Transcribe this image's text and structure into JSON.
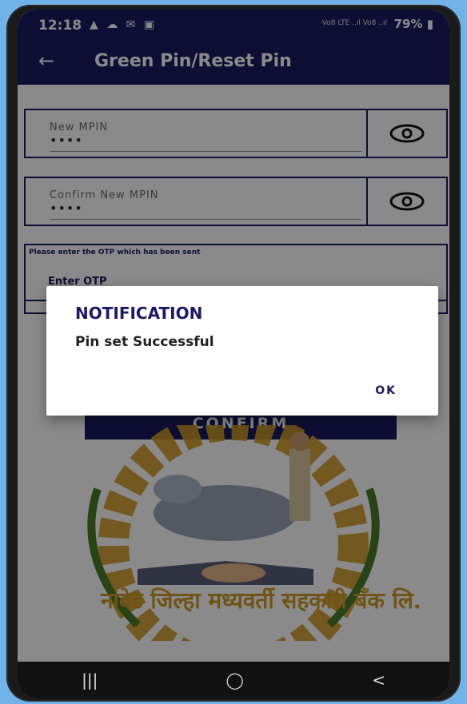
{
  "status": {
    "time": "12:18",
    "icons": "▲ ☁ ✉ ▣",
    "network": "Vo8 LTE ..ıl Vo8 ..ıl",
    "battery": "79%"
  },
  "appbar": {
    "title": "Green Pin/Reset Pin",
    "back_icon": "arrow-left-icon"
  },
  "form": {
    "new_mpin": {
      "label": "New MPIN",
      "value": "••••"
    },
    "confirm_mpin": {
      "label": "Confirm New MPIN",
      "value": "••••"
    },
    "otp": {
      "hint": "Please enter the OTP which has been sent",
      "label": "Enter OTP"
    },
    "confirm_button": "CONFIRM"
  },
  "logo": {
    "caption": "नांदेड जिल्हा मध्यवर्ती सहकारी बँक लि."
  },
  "dialog": {
    "title": "NOTIFICATION",
    "message": "Pin set Successful",
    "ok": "OK"
  },
  "navbar": {
    "recent": "|||",
    "home": "◯",
    "back": "<"
  },
  "colors": {
    "primary": "#1b1a63",
    "logo_gold": "#d09b27",
    "background": "#6fb3e8"
  }
}
